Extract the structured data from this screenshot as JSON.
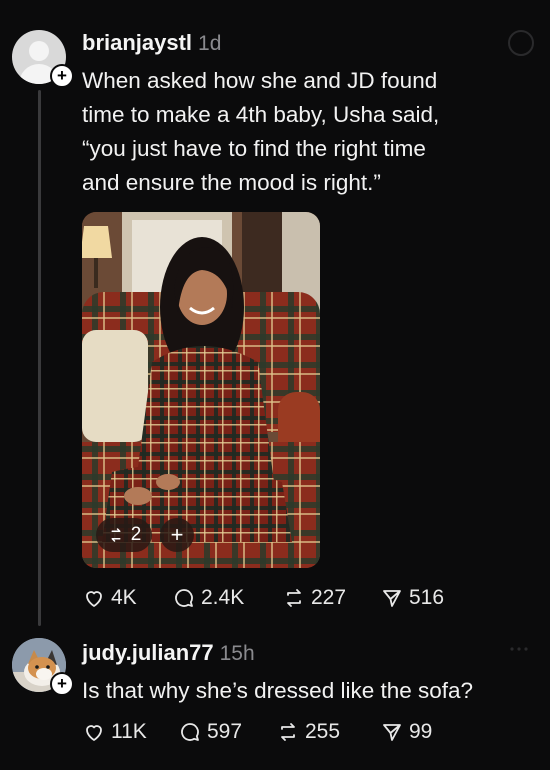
{
  "post1": {
    "username": "brianjaystl",
    "time": "1d",
    "text_lines": [
      "When asked how she and JD found",
      "time to make a 4th baby, Usha said,",
      "“you just have to find the right time",
      "and ensure the mood is right.”"
    ],
    "media": {
      "repost_count": "2",
      "add_label": "+"
    },
    "stats": {
      "likes": "4K",
      "replies": "2.4K",
      "reposts": "227",
      "shares": "516"
    }
  },
  "post2": {
    "username": "judy.julian77",
    "time": "15h",
    "text": "Is that why she’s dressed like the sofa?",
    "stats": {
      "likes": "11K",
      "replies": "597",
      "reposts": "255",
      "shares": "99"
    }
  },
  "icons": [
    "heart-icon",
    "comment-icon",
    "repost-icon",
    "share-icon",
    "plus-icon"
  ],
  "colors": {
    "background": "#0b0b0c",
    "muted": "#8a8a8e",
    "text": "#f2f2f2"
  }
}
